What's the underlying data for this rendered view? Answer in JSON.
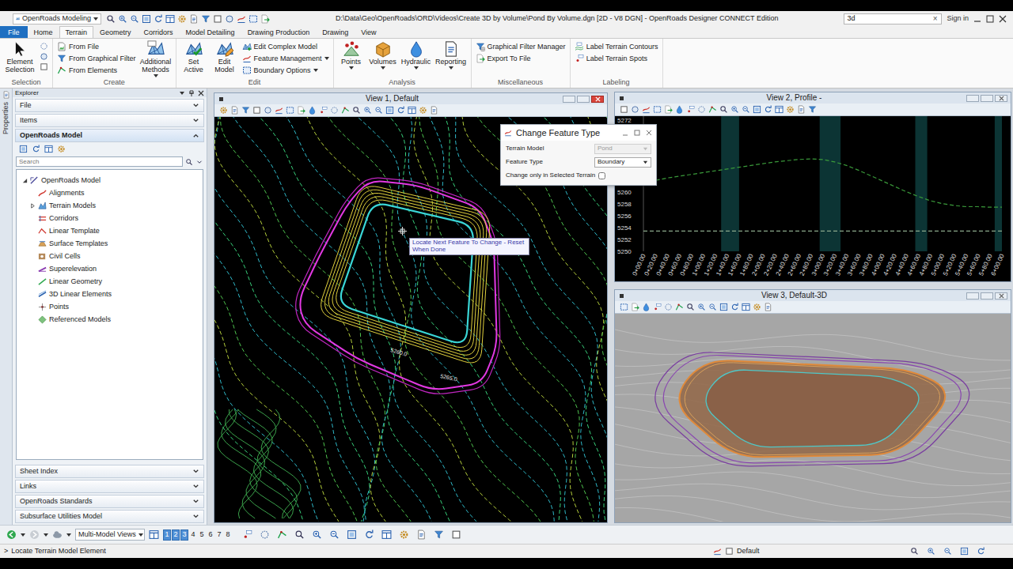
{
  "window": {
    "title": "D:\\Data\\Geo\\OpenRoads\\ORD\\Videos\\Create 3D by Volume\\Pond By Volume.dgn [2D - V8 DGN] - OpenRoads Designer CONNECT Edition",
    "workflow": "OpenRoads Modeling",
    "search": {
      "value": "3d",
      "clear": "×"
    },
    "sign_in": "Sign in"
  },
  "ribbon": {
    "tabs": [
      {
        "label": "File",
        "kind": "backstage",
        "selected": false
      },
      {
        "label": "Home",
        "kind": "tab",
        "selected": false
      },
      {
        "label": "Terrain",
        "kind": "tab",
        "selected": true
      },
      {
        "label": "Geometry",
        "kind": "tab",
        "selected": false
      },
      {
        "label": "Corridors",
        "kind": "tab",
        "selected": false
      },
      {
        "label": "Model Detailing",
        "kind": "tab",
        "selected": false
      },
      {
        "label": "Drawing Production",
        "kind": "tab",
        "selected": false
      },
      {
        "label": "Drawing",
        "kind": "tab",
        "selected": false
      },
      {
        "label": "View",
        "kind": "tab",
        "selected": false
      }
    ],
    "groups": [
      {
        "title": "Selection",
        "items": [
          "Element Selection"
        ]
      },
      {
        "title": "Create",
        "items": [
          "From File",
          "From Graphical Filter",
          "From Elements",
          "Additional Methods"
        ]
      },
      {
        "title": "Edit",
        "items": [
          "Set Active",
          "Edit Model",
          "Edit Complex Model",
          "Feature Management",
          "Boundary Options"
        ]
      },
      {
        "title": "Analysis",
        "items": [
          "Points",
          "Volumes",
          "Hydraulic",
          "Reporting"
        ]
      },
      {
        "title": "Miscellaneous",
        "items": [
          "Graphical Filter Manager",
          "Export To File"
        ]
      },
      {
        "title": "Labeling",
        "items": [
          "Label Terrain Contours",
          "Label Terrain Spots"
        ]
      }
    ]
  },
  "explorer": {
    "side_tab": "Properties",
    "title": "Explorer",
    "sections": [
      {
        "label": "File",
        "expanded": false
      },
      {
        "label": "Items",
        "expanded": false
      },
      {
        "label": "OpenRoads Model",
        "expanded": true
      }
    ],
    "search": {
      "placeholder": "Search"
    },
    "tree": {
      "root": {
        "label": "OpenRoads Model",
        "expanded": true
      },
      "items": [
        {
          "label": "Alignments",
          "expandable": false
        },
        {
          "label": "Terrain Models",
          "expandable": true,
          "expanded": false
        },
        {
          "label": "Corridors",
          "expandable": false
        },
        {
          "label": "Linear Template",
          "expandable": false
        },
        {
          "label": "Surface Templates",
          "expandable": false
        },
        {
          "label": "Civil Cells",
          "expandable": false
        },
        {
          "label": "Superelevation",
          "expandable": false
        },
        {
          "label": "Linear Geometry",
          "expandable": false
        },
        {
          "label": "3D Linear Elements",
          "expandable": false
        },
        {
          "label": "Points",
          "expandable": false
        },
        {
          "label": "Referenced Models",
          "expandable": false
        }
      ]
    },
    "bottom_sections": [
      {
        "label": "Sheet Index",
        "expanded": false
      },
      {
        "label": "Links",
        "expanded": false
      },
      {
        "label": "OpenRoads Standards",
        "expanded": false
      },
      {
        "label": "Subsurface Utilities Model",
        "expanded": false
      }
    ]
  },
  "views": [
    {
      "title": "View 1, Default",
      "active": true,
      "tooltip": "Locate Next Feature To Change - Reset When Done",
      "contour_labels": [
        "5260.0",
        "5265.0"
      ]
    },
    {
      "title": "View 2, Profile -",
      "active": false,
      "chart": {
        "y_ticks": [
          "5272",
          "5260",
          "5258",
          "5256",
          "5254",
          "5252",
          "5250"
        ],
        "stations": [
          0,
          20,
          40,
          60,
          80,
          100,
          120,
          140,
          160,
          180,
          200,
          220,
          240,
          260,
          280,
          300,
          320,
          340,
          360,
          380,
          400,
          420,
          440,
          460,
          480,
          500,
          520,
          540,
          560,
          580,
          600
        ],
        "station_labels": [
          "0+00.00",
          "0+20.00",
          "0+40.00",
          "0+60.00",
          "0+80.00",
          "1+00.00",
          "1+20.00",
          "1+40.00",
          "1+60.00",
          "1+80.00",
          "2+00.00",
          "2+20.00",
          "2+40.00",
          "2+60.00",
          "2+80.00",
          "3+00.00",
          "3+20.00",
          "3+40.00",
          "3+60.00",
          "3+80.00",
          "4+00.00",
          "4+20.00",
          "4+40.00",
          "4+60.00",
          "4+80.00",
          "5+00.00",
          "5+20.00",
          "5+40.00",
          "5+60.00",
          "5+80.00",
          "6+00.00"
        ],
        "bands": [
          [
            130,
            160
          ],
          [
            295,
            330
          ],
          [
            455,
            475
          ],
          [
            588,
            600
          ]
        ],
        "series": [
          {
            "color": "#3a9a3a",
            "values": [
              5261.5,
              5261.9,
              5262.3,
              5262.6,
              5262.9,
              5263.2,
              5263.5,
              5263.8,
              5264.1,
              5264.4,
              5264.7,
              5265.0,
              5265.2,
              5265.4,
              5265.5,
              5265.4,
              5265.0,
              5264.4,
              5263.6,
              5262.7,
              5261.8,
              5260.9,
              5260.0,
              5259.2,
              5258.5,
              5258.0,
              5257.7,
              5257.5,
              5257.5,
              5257.4,
              5257.4
            ]
          },
          {
            "color": "#8aa88a",
            "values": [
              5253.4,
              5253.4,
              5253.4,
              5253.4,
              5253.4,
              5253.4,
              5253.4,
              5253.4,
              5253.4,
              5253.4,
              5253.4,
              5253.4,
              5253.4,
              5253.4,
              5253.4,
              5253.4,
              5253.4,
              5253.4,
              5253.4,
              5253.4,
              5253.4,
              5253.4,
              5253.4,
              5253.4,
              5253.4,
              5253.4,
              5253.4,
              5253.4,
              5253.4,
              5253.4,
              5253.4
            ]
          }
        ]
      }
    },
    {
      "title": "View 3, Default-3D",
      "active": false
    }
  ],
  "dialog": {
    "title": "Change Feature Type",
    "fields": [
      {
        "label": "Terrain Model",
        "value": "Pond",
        "disabled": true
      },
      {
        "label": "Feature Type",
        "value": "Boundary",
        "disabled": false
      }
    ],
    "checkbox": {
      "label": "Change only in Selected Terrain",
      "checked": false
    }
  },
  "toolbar": {
    "model_views": "Multi-Model Views",
    "view_buttons": [
      {
        "label": "1",
        "on": true
      },
      {
        "label": "2",
        "on": true
      },
      {
        "label": "3",
        "on": true
      },
      {
        "label": "4",
        "on": false
      },
      {
        "label": "5",
        "on": false
      },
      {
        "label": "6",
        "on": false
      },
      {
        "label": "7",
        "on": false
      },
      {
        "label": "8",
        "on": false
      }
    ]
  },
  "status": {
    "prompt_marker": ">",
    "prompt": "Locate Terrain Model Element",
    "level": "Default"
  }
}
